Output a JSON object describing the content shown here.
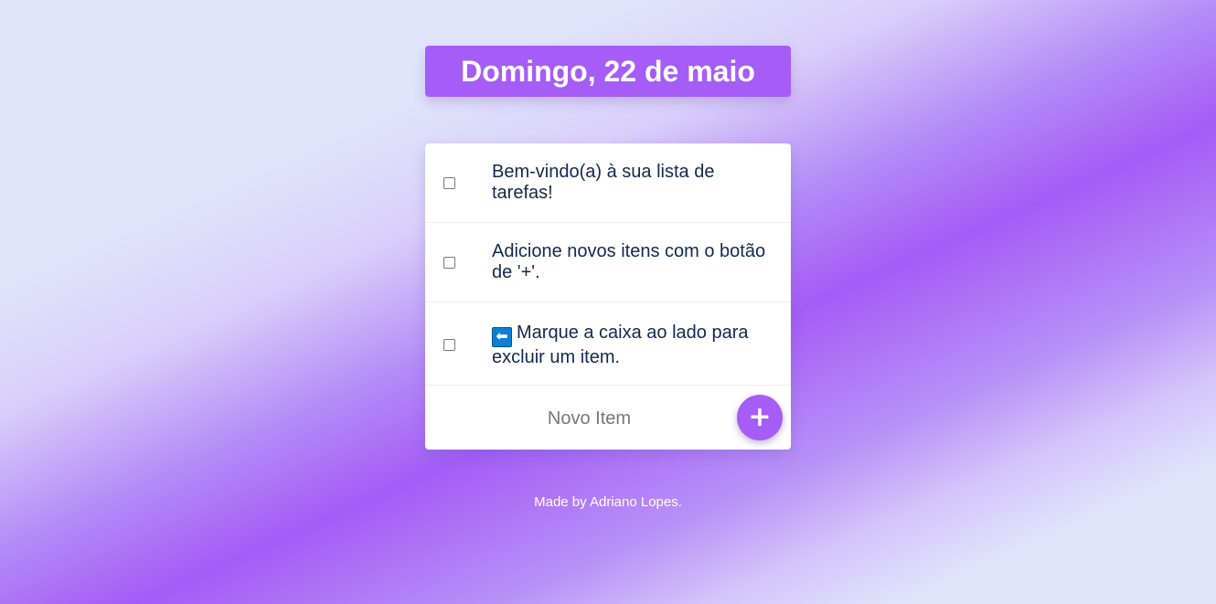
{
  "header": {
    "date_title": "Domingo, 22 de maio"
  },
  "todo": {
    "items": [
      {
        "text": "Bem-vindo(a) à sua lista de tarefas!",
        "checked": false
      },
      {
        "text": "Adicione novos itens com o botão de '+'.",
        "checked": false
      },
      {
        "icon": "left-arrow-icon",
        "icon_glyph": "⬅",
        "text": "Marque a caixa ao lado para excluir um item.",
        "checked": false
      }
    ],
    "new_item_placeholder": "Novo Item",
    "add_button_label": "+"
  },
  "footer": {
    "credit": "Made by Adriano Lopes."
  },
  "colors": {
    "accent": "#a65cf6",
    "text": "#142850",
    "background": "#e1e5fb"
  }
}
